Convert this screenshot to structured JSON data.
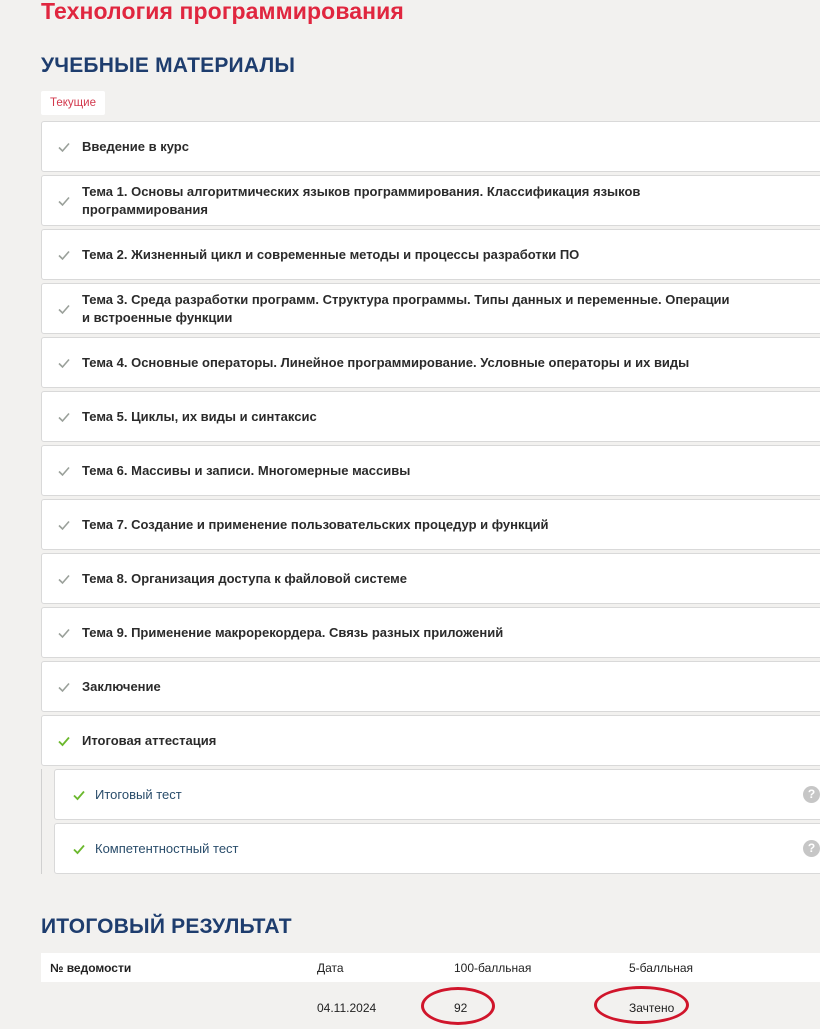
{
  "page": {
    "course_title": "Технология программирования",
    "materials_heading": "УЧЕБНЫЕ МАТЕРИАЛЫ",
    "tab_current": "Текущие",
    "result_heading": "ИТОГОВЫЙ РЕЗУЛЬТАТ"
  },
  "modules": [
    {
      "label": "Введение в курс",
      "status": "done"
    },
    {
      "label": "Тема 1. Основы алгоритмических языков программирования. Классификация языков программирования",
      "status": "done"
    },
    {
      "label": "Тема 2. Жизненный цикл и современные методы и процессы разработки ПО",
      "status": "done"
    },
    {
      "label": "Тема 3. Среда разработки программ. Структура программы. Типы данных и переменные. Операции и встроенные функции",
      "status": "done"
    },
    {
      "label": "Тема 4. Основные операторы. Линейное программирование. Условные операторы и их виды",
      "status": "done"
    },
    {
      "label": "Тема 5. Циклы, их виды и синтаксис",
      "status": "done"
    },
    {
      "label": "Тема 6. Массивы и записи. Многомерные массивы",
      "status": "done"
    },
    {
      "label": "Тема 7. Создание и применение пользовательских процедур и функций",
      "status": "done"
    },
    {
      "label": "Тема 8. Организация доступа к файловой системе",
      "status": "done"
    },
    {
      "label": "Тема 9. Применение макрорекордера. Связь разных приложений",
      "status": "done"
    },
    {
      "label": "Заключение",
      "status": "done"
    },
    {
      "label": "Итоговая аттестация",
      "status": "passed"
    }
  ],
  "submodules": [
    {
      "label": "Итоговый тест",
      "icon": "question-icon"
    },
    {
      "label": "Компетентностный тест",
      "icon": "question-icon"
    }
  ],
  "result": {
    "headers": {
      "no": "№ ведомости",
      "date": "Дата",
      "score_100": "100-балльная",
      "score_5": "5-балльная"
    },
    "row": {
      "no": "",
      "date": "04.11.2024",
      "score_100": "92",
      "score_5": "Зачтено"
    }
  },
  "colors": {
    "background": "#f2f1ef",
    "course_title": "#e0263f",
    "section_title": "#1e3d6e",
    "check_done": "#9aa09a",
    "check_passed": "#6bb82d",
    "annotation_ring": "#d0152b"
  }
}
